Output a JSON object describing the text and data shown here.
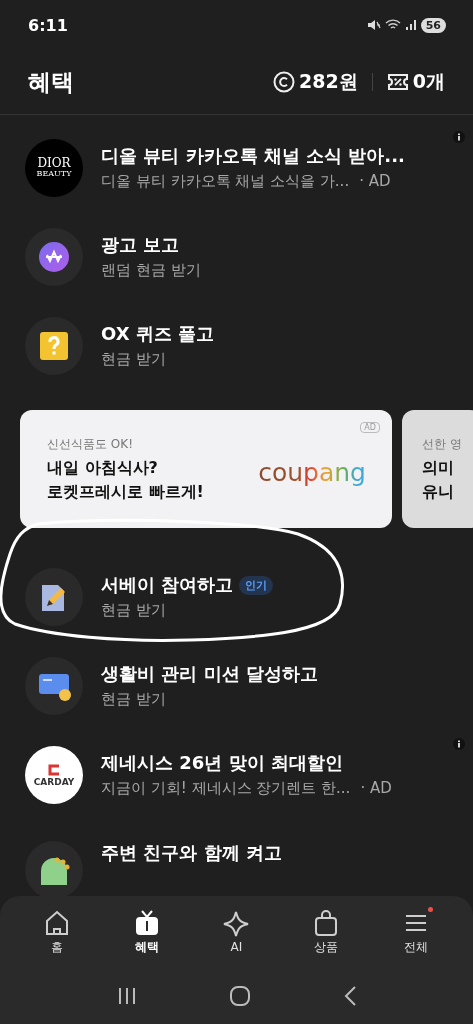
{
  "status_bar": {
    "time": "6:11",
    "battery": "56"
  },
  "header": {
    "title": "혜택",
    "points": "282원",
    "coupons": "0개"
  },
  "items": [
    {
      "kind": "ad",
      "logo_text": [
        "DIOR",
        "BEAUTY"
      ],
      "title": "디올 뷰티 카카오톡 채널 소식 받아...",
      "subtitle": "디올 뷰티 카카오톡 채널 소식을 가...",
      "tag": "· AD"
    },
    {
      "kind": "reward",
      "title": "광고 보고",
      "subtitle": "랜덤 현금 받기"
    },
    {
      "kind": "reward",
      "title": "OX 퀴즈 풀고",
      "subtitle": "현금 받기"
    },
    {
      "kind": "banners",
      "cards": [
        {
          "eyebrow": "신선식품도 OK!",
          "lines": [
            "내일 아침식사?",
            "로켓프레시로 빠르게!"
          ],
          "brand": "coupang",
          "ad_label": "AD"
        },
        {
          "eyebrow": "선한 영",
          "lines": [
            "의미",
            "유니"
          ]
        }
      ]
    },
    {
      "kind": "reward",
      "title": "서베이 참여하고",
      "badge": "인기",
      "subtitle": "현금 받기",
      "circled": true
    },
    {
      "kind": "reward",
      "title": "생활비 관리 미션 달성하고",
      "subtitle": "현금 받기"
    },
    {
      "kind": "ad",
      "logo_text": [
        "CARDAY"
      ],
      "title": "제네시스 26년 맞이 최대할인",
      "subtitle": "지금이 기회! 제네시스 장기렌트 한...",
      "tag": "· AD"
    },
    {
      "kind": "reward",
      "title": "주변 친구와 함께 켜고"
    }
  ],
  "tabs": [
    {
      "label": "홈",
      "selected": false,
      "new": false
    },
    {
      "label": "혜택",
      "selected": true,
      "new": false
    },
    {
      "label": "AI",
      "selected": false,
      "new": false
    },
    {
      "label": "상품",
      "selected": false,
      "new": false
    },
    {
      "label": "전체",
      "selected": false,
      "new": true
    }
  ]
}
